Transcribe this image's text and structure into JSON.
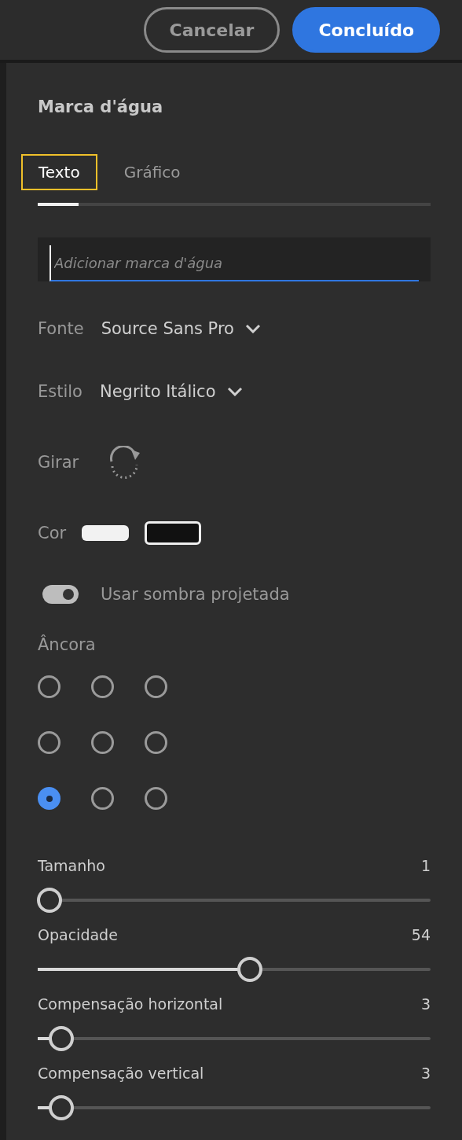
{
  "header": {
    "buttons": [
      {
        "label": "Cancelar",
        "kind": "secondary"
      },
      {
        "label": "Concluído",
        "kind": "primary"
      }
    ]
  },
  "panel": {
    "title": "Marca d'água",
    "tabs": [
      {
        "label": "Texto",
        "selected": true
      },
      {
        "label": "Gráfico",
        "selected": false
      }
    ],
    "text_field": {
      "placeholder": "Adicionar marca d'água"
    },
    "font": {
      "label": "Fonte",
      "value": "Source Sans Pro"
    },
    "style": {
      "label": "Estilo",
      "value": "Negrito Itálico"
    },
    "rotate": {
      "label": "Girar"
    },
    "color": {
      "label": "Cor",
      "swatches": [
        {
          "color": "#f2f2f2",
          "selected": false
        },
        {
          "color": "#111111",
          "selected": true
        }
      ]
    },
    "shadow": {
      "label": "Usar sombra projetada",
      "on": true
    },
    "anchor": {
      "label": "Âncora",
      "options": [
        {
          "selected": false
        },
        {
          "selected": false
        },
        {
          "selected": false
        },
        {
          "selected": false
        },
        {
          "selected": false
        },
        {
          "selected": false
        },
        {
          "selected": true
        },
        {
          "selected": false
        },
        {
          "selected": false
        }
      ]
    },
    "sliders": [
      {
        "label": "Tamanho",
        "reading": "1",
        "level": 0.03
      },
      {
        "label": "Opacidade",
        "reading": "54",
        "level": 0.54
      },
      {
        "label": "Compensação horizontal",
        "reading": "3",
        "level": 0.06
      },
      {
        "label": "Compensação vertical",
        "reading": "3",
        "level": 0.06
      }
    ]
  }
}
